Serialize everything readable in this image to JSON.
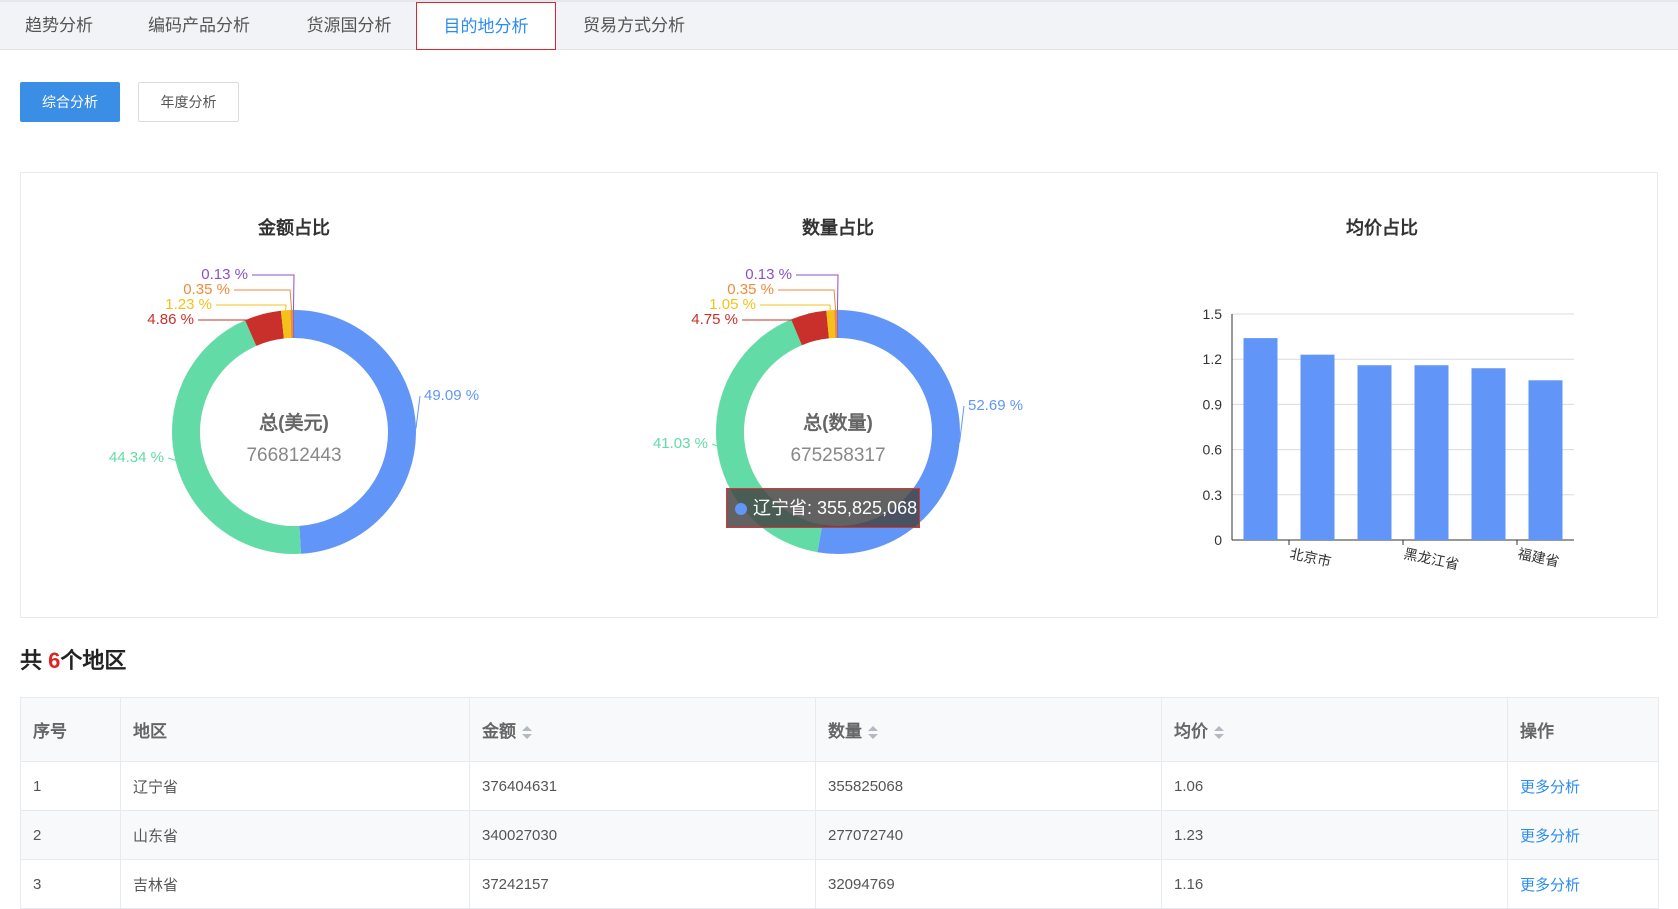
{
  "tabs": [
    {
      "label": "趋势分析",
      "active": false
    },
    {
      "label": "编码产品分析",
      "active": false
    },
    {
      "label": "货源国分析",
      "active": false
    },
    {
      "label": "目的地分析",
      "active": true
    },
    {
      "label": "贸易方式分析",
      "active": false
    }
  ],
  "buttons": {
    "combined": "综合分析",
    "annual": "年度分析"
  },
  "colors": {
    "blue": "#6196f8",
    "green": "#62dba7",
    "red": "#c9302c",
    "yellow": "#f5c118",
    "orange": "#f08a3c",
    "purple": "#8e4fc5",
    "accent": "#3a8ee6"
  },
  "chart_data": [
    {
      "type": "pie",
      "title": "金额占比",
      "center_label": "总(美元)",
      "center_value": "766812443",
      "slices": [
        {
          "label": "49.09 %",
          "value": 49.09,
          "color": "#6196f8"
        },
        {
          "label": "44.34 %",
          "value": 44.34,
          "color": "#62dba7"
        },
        {
          "label": "4.86 %",
          "value": 4.86,
          "color": "#c9302c"
        },
        {
          "label": "1.23 %",
          "value": 1.23,
          "color": "#f5c118"
        },
        {
          "label": "0.35 %",
          "value": 0.35,
          "color": "#f08a3c"
        },
        {
          "label": "0.13 %",
          "value": 0.13,
          "color": "#8e4fc5"
        }
      ]
    },
    {
      "type": "pie",
      "title": "数量占比",
      "center_label": "总(数量)",
      "center_value": "675258317",
      "tooltip": "辽宁省: 355,825,068",
      "slices": [
        {
          "label": "52.69 %",
          "value": 52.69,
          "color": "#6196f8"
        },
        {
          "label": "41.03 %",
          "value": 41.03,
          "color": "#62dba7"
        },
        {
          "label": "4.75 %",
          "value": 4.75,
          "color": "#c9302c"
        },
        {
          "label": "1.05 %",
          "value": 1.05,
          "color": "#f5c118"
        },
        {
          "label": "0.35 %",
          "value": 0.35,
          "color": "#f08a3c"
        },
        {
          "label": "0.13 %",
          "value": 0.13,
          "color": "#8e4fc5"
        }
      ]
    },
    {
      "type": "bar",
      "title": "均价占比",
      "tick_labels": [
        "北京市",
        "黑龙江省",
        "福建省"
      ],
      "values": [
        1.34,
        1.23,
        1.16,
        1.16,
        1.14,
        1.06
      ],
      "ylim": [
        0,
        1.5
      ],
      "yticks": [
        "0",
        "0.3",
        "0.6",
        "0.9",
        "1.2",
        "1.5"
      ],
      "color": "#6196f8"
    }
  ],
  "summary": {
    "prefix": "共",
    "count": "6",
    "suffix": "个地区"
  },
  "table": {
    "headers": [
      "序号",
      "地区",
      "金额",
      "数量",
      "均价",
      "操作"
    ],
    "rows": [
      {
        "no": "1",
        "region": "辽宁省",
        "amount": "376404631",
        "quantity": "355825068",
        "price": "1.06",
        "action": "更多分析"
      },
      {
        "no": "2",
        "region": "山东省",
        "amount": "340027030",
        "quantity": "277072740",
        "price": "1.23",
        "action": "更多分析"
      },
      {
        "no": "3",
        "region": "吉林省",
        "amount": "37242157",
        "quantity": "32094769",
        "price": "1.16",
        "action": "更多分析"
      }
    ]
  }
}
